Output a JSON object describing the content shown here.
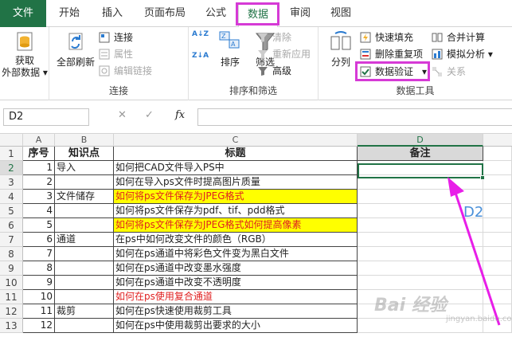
{
  "tabs": [
    "文件",
    "开始",
    "插入",
    "页面布局",
    "公式",
    "数据",
    "审阅",
    "视图"
  ],
  "ribbon": {
    "get_data": [
      "获取",
      "外部数据 ▾"
    ],
    "refresh_all": [
      "全部刷新"
    ],
    "conn": {
      "connections": "连接",
      "properties": "属性",
      "edit_links": "编辑链接",
      "group": "连接"
    },
    "sort": {
      "az": "A↓Z",
      "za": "Z↓A",
      "sort": "排序",
      "filter": "筛选",
      "clear": "清除",
      "reapply": "重新应用",
      "advanced": "高级",
      "group": "排序和筛选"
    },
    "tools": {
      "split": "分列",
      "flash_fill": "快速填充",
      "remove_dup": "删除重复项",
      "validation": "数据验证",
      "validation_arrow": "▾",
      "consolidate": "合并计算",
      "what_if": "模拟分析 ▾",
      "relations": "关系",
      "group": "数据工具"
    }
  },
  "formula_bar": {
    "name_box": "D2",
    "fx": "fx",
    "cancel": "✕",
    "confirm": "✓"
  },
  "columns": [
    "A",
    "B",
    "C",
    "D"
  ],
  "rows": [
    {
      "n": "1",
      "a": "序号",
      "b": "知识点",
      "c": "标题",
      "d": "备注"
    },
    {
      "n": "2",
      "a": "1",
      "b": "导入",
      "c": "如何把CAD文件导入PS中",
      "d": ""
    },
    {
      "n": "3",
      "a": "2",
      "b": "",
      "c": "如何在导入ps文件时提高图片质量",
      "d": ""
    },
    {
      "n": "4",
      "a": "3",
      "b": "文件储存",
      "c": "如何将ps文件保存为JPEG格式",
      "d": ""
    },
    {
      "n": "5",
      "a": "4",
      "b": "",
      "c": "如何将ps文件保存为pdf、tif、pdd格式",
      "d": ""
    },
    {
      "n": "6",
      "a": "5",
      "b": "",
      "c": "如何将ps文件保存为JPEG格式如何提高像素",
      "d": ""
    },
    {
      "n": "7",
      "a": "6",
      "b": "通道",
      "c": "在ps中如何改变文件的颜色（RGB）",
      "d": ""
    },
    {
      "n": "8",
      "a": "7",
      "b": "",
      "c": "如何在ps通道中将彩色文件变为黑白文件",
      "d": ""
    },
    {
      "n": "9",
      "a": "8",
      "b": "",
      "c": "如何在ps通道中改变墨水强度",
      "d": ""
    },
    {
      "n": "10",
      "a": "9",
      "b": "",
      "c": "如何在ps通道中改变不透明度",
      "d": ""
    },
    {
      "n": "11",
      "a": "10",
      "b": "",
      "c": "如何在ps使用复合通道",
      "d": ""
    },
    {
      "n": "12",
      "a": "11",
      "b": "裁剪",
      "c": "如何在ps快速使用裁剪工具",
      "d": ""
    },
    {
      "n": "13",
      "a": "12",
      "b": "",
      "c": "如何在ps中使用裁剪出要求的大小",
      "d": ""
    }
  ],
  "annotation": "D2",
  "watermark": "Bai 经验",
  "watermark2": "jingyan.baidu.com",
  "colors": {
    "accent": "#217346",
    "highlight": "#d63ad6",
    "yellow": "#ffff00",
    "red_text": "#e02020"
  }
}
